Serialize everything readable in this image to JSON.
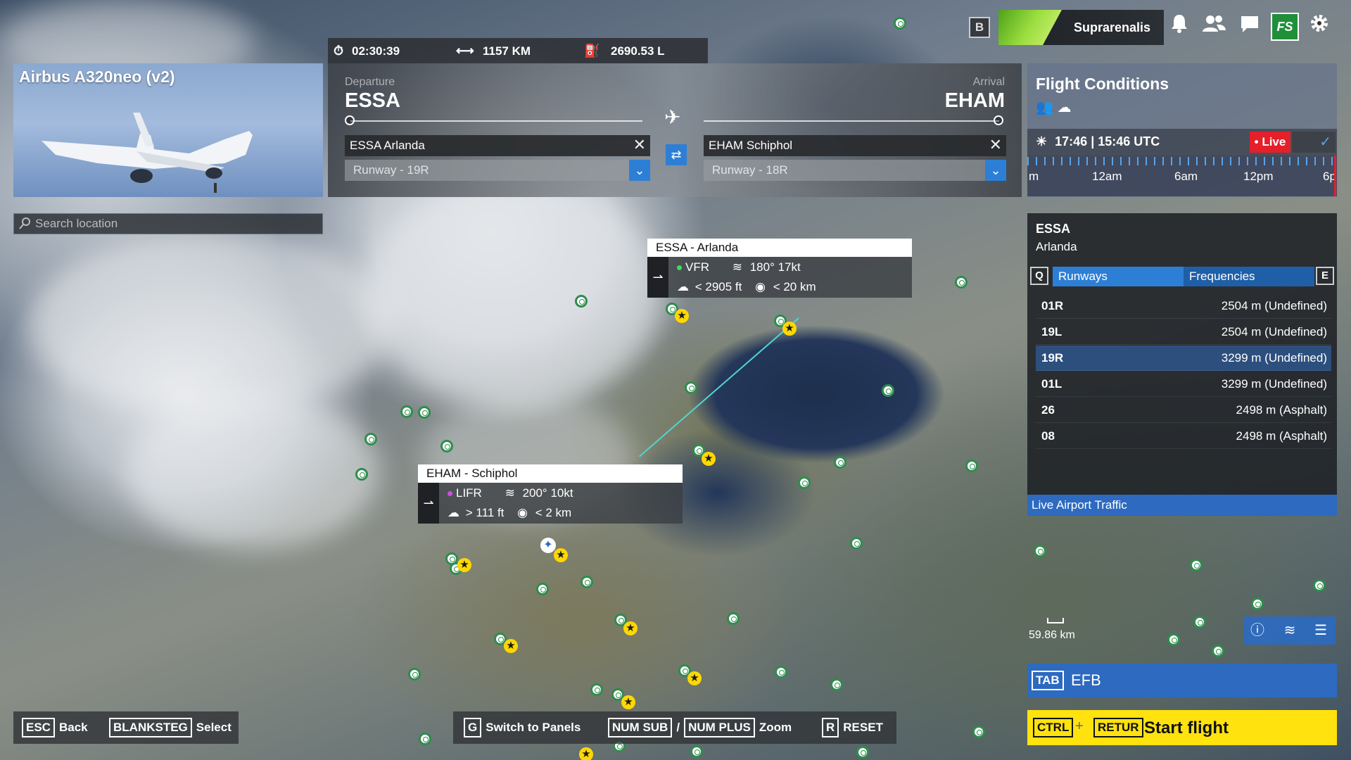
{
  "topbar": {
    "b_key": "B",
    "username": "Suprarenalis",
    "icons": [
      "bell-icon",
      "friends-icon",
      "chat-icon",
      "shop-icon",
      "gear-icon"
    ],
    "shop_label": "FS"
  },
  "aircraft": {
    "name": "Airbus A320neo (v2)"
  },
  "search": {
    "placeholder": "Search location"
  },
  "stats": {
    "duration": "02:30:39",
    "distance": "1157 KM",
    "fuel": "2690.53 L"
  },
  "route": {
    "departure_label": "Departure",
    "departure_code": "ESSA",
    "departure_airport": "ESSA Arlanda",
    "departure_runway": "Runway - 19R",
    "arrival_label": "Arrival",
    "arrival_code": "EHAM",
    "arrival_airport": "EHAM Schiphol",
    "arrival_runway": "Runway - 18R"
  },
  "popups": {
    "essa": {
      "title": "ESSA - Arlanda",
      "category": "VFR",
      "category_color": "#3ddc5a",
      "wind": "180° 17kt",
      "ceiling": "< 2905 ft",
      "visibility": "< 20 km"
    },
    "eham": {
      "title": "EHAM - Schiphol",
      "category": "LIFR",
      "category_color": "#d04ee0",
      "wind": "200° 10kt",
      "ceiling": "> 111 ft",
      "visibility": "< 2 km"
    }
  },
  "conditions": {
    "title": "Flight Conditions",
    "time": "17:46 | 15:46 UTC",
    "live_label": "• Live",
    "timeline": [
      "m",
      "12am",
      "6am",
      "12pm",
      "6p"
    ]
  },
  "airport_info": {
    "code": "ESSA",
    "name": "Arlanda",
    "tab_left_key": "Q",
    "tab_right_key": "E",
    "tabs": [
      "Runways",
      "Frequencies"
    ],
    "runways": [
      {
        "id": "01R",
        "length": "2504 m (Undefined)"
      },
      {
        "id": "19L",
        "length": "2504 m (Undefined)"
      },
      {
        "id": "19R",
        "length": "3299 m (Undefined)"
      },
      {
        "id": "01L",
        "length": "3299 m (Undefined)"
      },
      {
        "id": "26",
        "length": "2498 m (Asphalt)"
      },
      {
        "id": "08",
        "length": "2498 m (Asphalt)"
      }
    ],
    "selected_runway": "19R",
    "traffic_label": "Live Airport Traffic"
  },
  "map": {
    "scale": "59.86 km"
  },
  "efb": {
    "key": "TAB",
    "label": "EFB"
  },
  "start": {
    "key1": "CTRL",
    "plus": "+",
    "key2": "RETUR",
    "label": "Start flight"
  },
  "controls": {
    "back_key": "ESC",
    "back_label": "Back",
    "select_key": "BLANKSTEG",
    "select_label": "Select",
    "switch_key": "G",
    "switch_label": "Switch to Panels",
    "zoom_out_key": "NUM SUB",
    "separator": "/",
    "zoom_in_key": "NUM PLUS",
    "zoom_label": "Zoom",
    "reset_key": "R",
    "reset_label": "RESET"
  },
  "colors": {
    "accent_blue": "#2d7fd6",
    "live_red": "#e4202a",
    "start_yellow": "#ffe20e",
    "route_cyan": "#4fd6d2"
  }
}
